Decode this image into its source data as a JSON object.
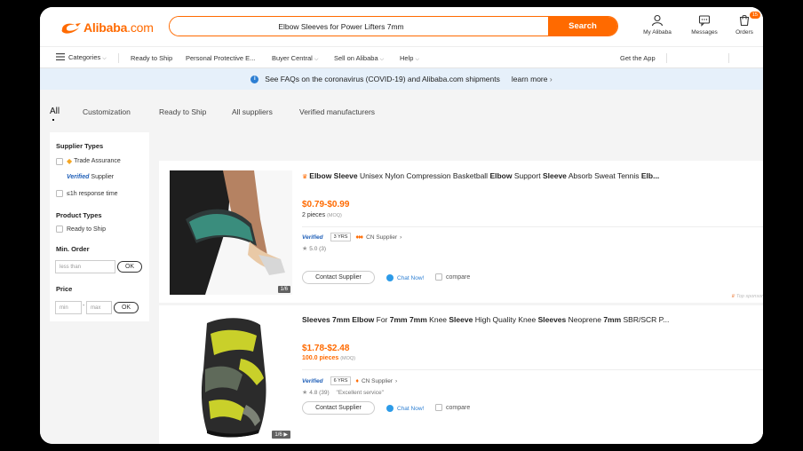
{
  "header": {
    "logo_text": "Alibaba",
    "logo_suffix": ".com",
    "search_value": "Elbow Sleeves for Power Lifters 7mm",
    "search_button": "Search",
    "my_alibaba": "My Alibaba",
    "messages": "Messages",
    "orders": "Orders",
    "orders_badge": "15"
  },
  "nav": {
    "categories": "Categories",
    "ready_to_ship": "Ready to Ship",
    "ppe": "Personal Protective E...",
    "buyer_central": "Buyer Central",
    "sell": "Sell on Alibaba",
    "help": "Help",
    "get_app": "Get the App"
  },
  "banner": {
    "text": "See FAQs on the coronavirus (COVID-19) and Alibaba.com shipments",
    "learn_more": "learn more"
  },
  "tabs": [
    "All",
    "Customization",
    "Ready to Ship",
    "All suppliers",
    "Verified manufacturers"
  ],
  "sidebar": {
    "supplier_types_title": "Supplier Types",
    "trade_assurance": "Trade Assurance",
    "verified_label": "Verified",
    "supplier_label": "Supplier",
    "response_time": "≤1h response time",
    "product_types_title": "Product Types",
    "ready_to_ship": "Ready to Ship",
    "min_order_title": "Min. Order",
    "less_than_placeholder": "less than",
    "ok": "OK",
    "price_title": "Price",
    "min_placeholder": "min",
    "max_placeholder": "max",
    "dash": "-"
  },
  "products": [
    {
      "title_parts": [
        {
          "t": "Elbow Sleeve",
          "b": true
        },
        {
          "t": " Unisex Nylon Compression Basketball ",
          "b": false
        },
        {
          "t": "Elbow",
          "b": true
        },
        {
          "t": " Support ",
          "b": false
        },
        {
          "t": "Sleeve",
          "b": true
        },
        {
          "t": " Absorb Sweat Tennis ",
          "b": false
        },
        {
          "t": "Elb...",
          "b": true
        }
      ],
      "price": "$0.79-$0.99",
      "moq": "2 pieces",
      "moq_label": "(MOQ)",
      "verified": "Verified",
      "years": "3 YRS",
      "supplier": "CN Supplier",
      "rating": "5.0",
      "reviews": "(3)",
      "review_quote": "",
      "contact": "Contact Supplier",
      "chat": "Chat Now!",
      "compare": "compare",
      "img_count": "1/6",
      "top_spot": "Top sponsor"
    },
    {
      "title_parts": [
        {
          "t": "Sleeves 7mm Elbow",
          "b": true
        },
        {
          "t": " For ",
          "b": false
        },
        {
          "t": "7mm 7mm",
          "b": true
        },
        {
          "t": " Knee ",
          "b": false
        },
        {
          "t": "Sleeve",
          "b": true
        },
        {
          "t": " High Quality Knee ",
          "b": false
        },
        {
          "t": "Sleeves",
          "b": true
        },
        {
          "t": " Neoprene ",
          "b": false
        },
        {
          "t": "7mm",
          "b": true
        },
        {
          "t": " SBR/SCR P...",
          "b": false
        }
      ],
      "price": "$1.78-$2.48",
      "moq": "100.0 pieces",
      "moq_label": "(MOQ)",
      "verified": "Verified",
      "years": "6 YRS",
      "supplier": "CN Supplier",
      "rating": "4.8",
      "reviews": "(39)",
      "review_quote": "\"Excellent service\"",
      "contact": "Contact Supplier",
      "chat": "Chat Now!",
      "compare": "compare",
      "img_count": "1/6"
    }
  ]
}
